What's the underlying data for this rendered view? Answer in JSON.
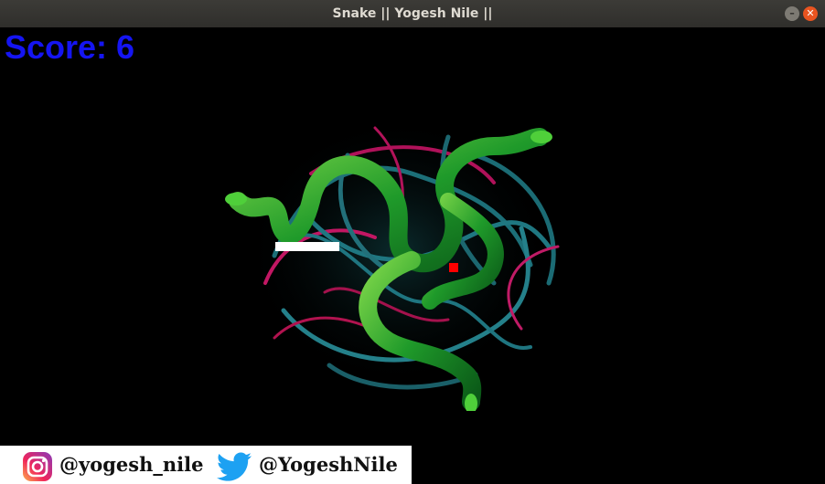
{
  "window": {
    "title": "Snake || Yogesh Nile ||"
  },
  "score": {
    "label": "Score:",
    "value": "6"
  },
  "social": {
    "instagram_handle": "@yogesh_nile",
    "twitter_handle": "@YogeshNile",
    "instagram_icon": "instagram-icon",
    "twitter_icon": "twitter-icon"
  },
  "colors": {
    "score_text": "#1515f2",
    "snake": "#ffffff",
    "food": "#ff0000",
    "background": "#000000"
  }
}
